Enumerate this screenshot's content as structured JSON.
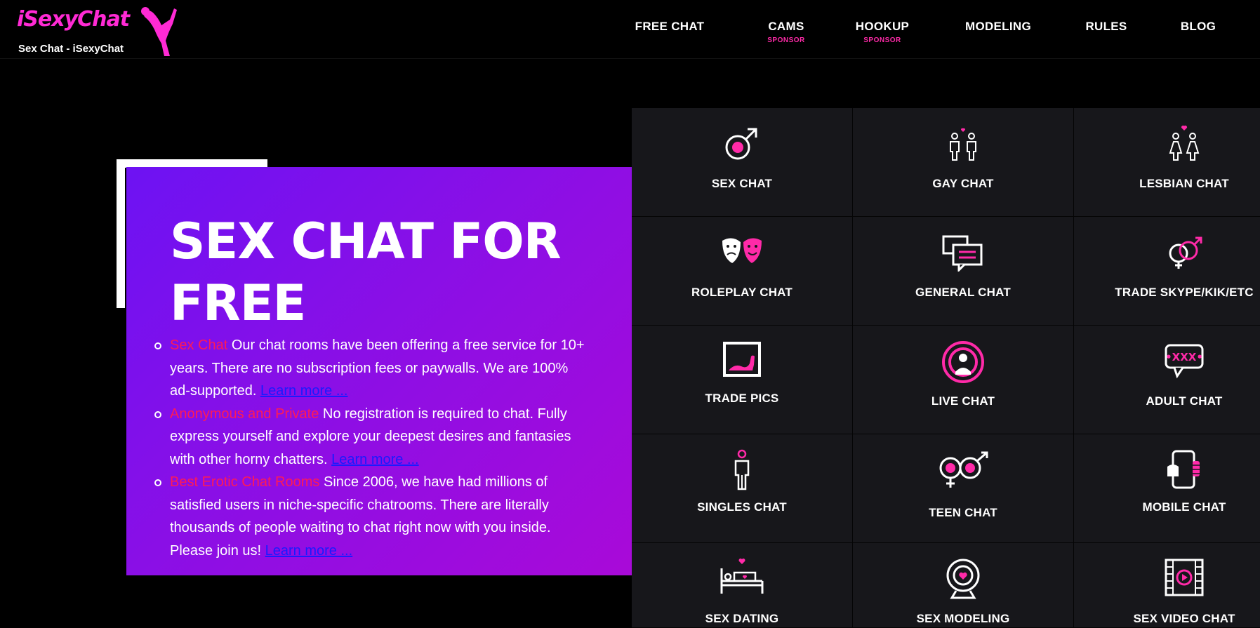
{
  "brand": {
    "logo_text": "iSexyChat",
    "tagline": "Sex Chat - iSexyChat",
    "accent_color": "#ff2ad4"
  },
  "nav": [
    {
      "label": "FREE CHAT",
      "sub": ""
    },
    {
      "label": "CAMS",
      "sub": "SPONSOR"
    },
    {
      "label": "HOOKUP",
      "sub": "SPONSOR"
    },
    {
      "label": "MODELING",
      "sub": ""
    },
    {
      "label": "RULES",
      "sub": ""
    },
    {
      "label": "BLOG",
      "sub": ""
    }
  ],
  "hero": {
    "title": "SEX CHAT FOR FREE",
    "items": [
      {
        "highlight": "Sex Chat",
        "text": " Our chat rooms have been offering a free service for 10+ years. There are no subscription fees or paywalls. We are 100% ad-supported. ",
        "link": "Learn more ..."
      },
      {
        "highlight": "Anonymous and Private",
        "text": " No registration is required to chat. Fully express yourself and explore your deepest desires and fantasies with other horny chatters. ",
        "link": "Learn more ..."
      },
      {
        "highlight": "Best Erotic Chat Rooms",
        "text": " Since 2006, we have had millions of satisfied users in niche-specific chatrooms. There are literally thousands of people waiting to chat right now with you inside. Please join us! ",
        "link": "Learn more ..."
      }
    ],
    "gradient_start": "#6d12f3",
    "gradient_end": "#a90ad8",
    "highlight_color": "#ff1a55",
    "link_color": "#1a1aff"
  },
  "categories": [
    {
      "label": "SEX CHAT",
      "icon": "male-symbol-icon"
    },
    {
      "label": "GAY CHAT",
      "icon": "gay-couple-icon"
    },
    {
      "label": "LESBIAN CHAT",
      "icon": "lesbian-couple-icon"
    },
    {
      "label": "ROLEPLAY CHAT",
      "icon": "theater-masks-icon"
    },
    {
      "label": "GENERAL CHAT",
      "icon": "chat-bubbles-icon"
    },
    {
      "label": "TRADE SKYPE/KIK/ETC",
      "icon": "gender-symbols-icon"
    },
    {
      "label": "TRADE PICS",
      "icon": "picture-frame-icon"
    },
    {
      "label": "LIVE CHAT",
      "icon": "live-broadcast-icon"
    },
    {
      "label": "ADULT CHAT",
      "icon": "xxx-bubble-icon"
    },
    {
      "label": "SINGLES CHAT",
      "icon": "single-person-icon"
    },
    {
      "label": "TEEN CHAT",
      "icon": "infinity-gender-icon"
    },
    {
      "label": "MOBILE CHAT",
      "icon": "mobile-phone-icon"
    },
    {
      "label": "SEX DATING",
      "icon": "bed-heart-icon"
    },
    {
      "label": "SEX MODELING",
      "icon": "webcam-heart-icon"
    },
    {
      "label": "SEX VIDEO CHAT",
      "icon": "film-play-icon"
    }
  ]
}
